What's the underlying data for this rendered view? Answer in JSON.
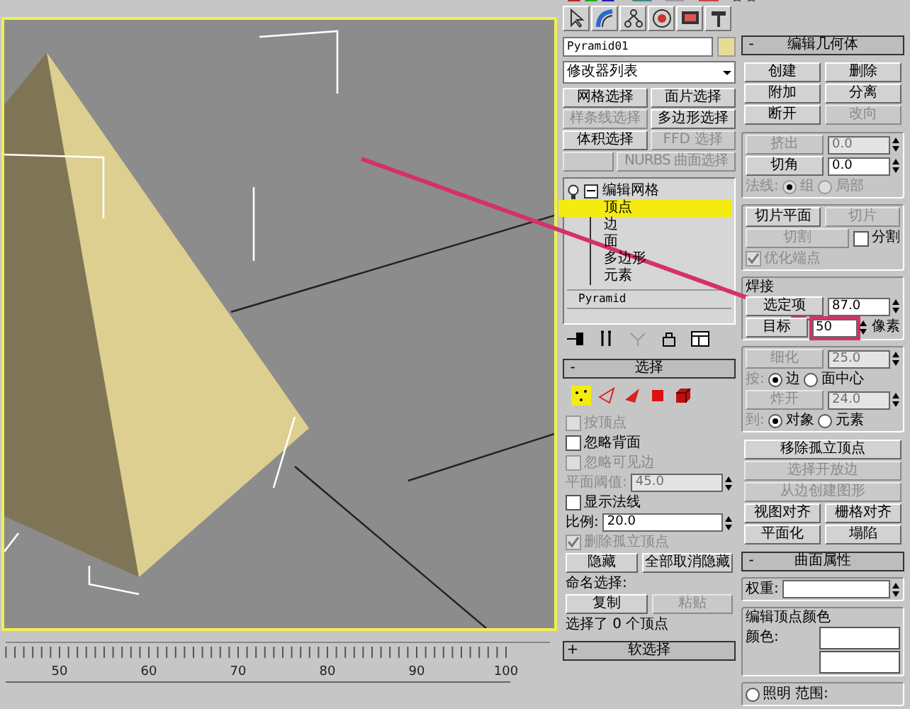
{
  "timeline": {
    "labels": [
      "50",
      "60",
      "70",
      "80",
      "90",
      "100"
    ]
  },
  "object_name": {
    "value": "Pyramid01"
  },
  "modifier_list": {
    "value": "修改器列表"
  },
  "modifier_buttons": [
    {
      "label": "网格选择",
      "disabled": false
    },
    {
      "label": "面片选择",
      "disabled": false
    },
    {
      "label": "样条线选择",
      "disabled": true
    },
    {
      "label": "多边形选择",
      "disabled": false
    },
    {
      "label": "体积选择",
      "disabled": false
    },
    {
      "label": "FFD 选择",
      "disabled": true
    },
    {
      "disabled": true
    },
    {
      "label": "NURBS 曲面选择",
      "disabled": true
    }
  ],
  "stack": [
    {
      "label": "编辑网格",
      "expanded": true,
      "children": [
        {
          "label": "顶点",
          "selected": true
        },
        {
          "label": "边",
          "selected": false
        },
        {
          "label": "面",
          "selected": false
        },
        {
          "label": "多边形",
          "selected": false
        },
        {
          "label": "元素",
          "selected": false
        }
      ]
    },
    {
      "label": "Pyramid"
    }
  ],
  "selection": {
    "title": "选择",
    "sign": "-",
    "levels": [
      {
        "kind": "vertex",
        "selected": true
      },
      {
        "kind": "edge",
        "selected": false
      },
      {
        "kind": "face",
        "selected": false
      },
      {
        "kind": "polygon",
        "selected": false
      },
      {
        "kind": "element",
        "selected": false
      }
    ],
    "rows": [
      {
        "items": [
          {
            "kind": "checkbox",
            "label": "按顶点",
            "checked": false,
            "disabled": true
          }
        ]
      },
      {
        "items": [
          {
            "kind": "checkbox",
            "label": "忽略背面",
            "checked": false,
            "disabled": false
          }
        ]
      },
      {
        "items": [
          {
            "kind": "checkbox",
            "label": "忽略可见边",
            "checked": false,
            "disabled": true
          }
        ]
      },
      {
        "items": [
          {
            "kind": "label",
            "text": "平面阈值:",
            "disabled": true
          },
          {
            "kind": "field",
            "value": "45.0",
            "disabled": true
          }
        ]
      },
      {
        "items": [
          {
            "kind": "checkbox",
            "label": "显示法线",
            "checked": false,
            "disabled": false
          }
        ]
      },
      {
        "items": [
          {
            "kind": "label",
            "text": "比例:",
            "disabled": false
          },
          {
            "kind": "field",
            "value": "20.0",
            "disabled": false
          }
        ]
      },
      {
        "items": [
          {
            "kind": "checkbox",
            "label": "删除孤立顶点",
            "checked": true,
            "disabled": true
          }
        ]
      },
      {
        "items": [
          {
            "kind": "button",
            "label": "隐藏",
            "disabled": false
          },
          {
            "kind": "button",
            "label": "全部取消隐藏",
            "disabled": false
          }
        ]
      },
      {
        "items": [
          {
            "kind": "label",
            "text": "命名选择:",
            "disabled": false
          }
        ]
      },
      {
        "items": [
          {
            "kind": "button",
            "label": "复制",
            "disabled": false
          },
          {
            "kind": "button",
            "label": "粘贴",
            "disabled": true
          }
        ]
      },
      {
        "items": [
          {
            "kind": "label",
            "text": "选择了 0 个顶点",
            "disabled": false
          }
        ]
      }
    ]
  },
  "soft_selection": {
    "title": "软选择",
    "sign": "+"
  },
  "edit_geometry": {
    "title": "编辑几何体",
    "sign": "-",
    "groups": [
      {
        "boxed": false,
        "rows": [
          {
            "items": [
              {
                "kind": "button",
                "label": "创建",
                "disabled": false
              },
              {
                "kind": "button",
                "label": "删除",
                "disabled": false
              }
            ]
          },
          {
            "items": [
              {
                "kind": "button",
                "label": "附加",
                "disabled": false
              },
              {
                "kind": "button",
                "label": "分离",
                "disabled": false
              }
            ]
          },
          {
            "items": [
              {
                "kind": "button",
                "label": "断开",
                "disabled": false
              },
              {
                "kind": "button",
                "label": "改向",
                "disabled": true
              }
            ]
          }
        ]
      },
      {
        "boxed": true,
        "rows": [
          {
            "items": [
              {
                "kind": "button",
                "label": "挤出",
                "disabled": true
              },
              {
                "kind": "field",
                "value": "0.0",
                "disabled": true
              }
            ]
          },
          {
            "items": [
              {
                "kind": "button",
                "label": "切角",
                "disabled": false
              },
              {
                "kind": "field",
                "value": "0.0",
                "disabled": false
              }
            ]
          },
          {
            "items": [
              {
                "kind": "label",
                "text": "法线:",
                "disabled": true
              },
              {
                "kind": "radio",
                "label": "组",
                "selected": true,
                "disabled": true
              },
              {
                "kind": "radio",
                "label": "局部",
                "selected": false,
                "disabled": true
              }
            ]
          }
        ]
      },
      {
        "boxed": true,
        "rows": [
          {
            "items": [
              {
                "kind": "button",
                "label": "切片平面",
                "disabled": false
              },
              {
                "kind": "button",
                "label": "切片",
                "disabled": true
              }
            ]
          },
          {
            "items": [
              {
                "kind": "button",
                "label": "切割",
                "disabled": true
              },
              {
                "kind": "checkbox",
                "label": "分割",
                "checked": false,
                "disabled": false
              }
            ]
          },
          {
            "items": [
              {
                "kind": "checkbox",
                "label": "优化端点",
                "checked": true,
                "disabled": true
              }
            ]
          }
        ]
      },
      {
        "boxed": true,
        "title": "焊接",
        "rows": [
          {
            "items": [
              {
                "kind": "button",
                "label": "选定项",
                "disabled": false
              },
              {
                "kind": "field",
                "value": "87.0",
                "disabled": false
              }
            ]
          },
          {
            "items": [
              {
                "kind": "button",
                "label": "目标",
                "disabled": false
              },
              {
                "kind": "field",
                "value": "50",
                "disabled": false,
                "highlighted": true
              },
              {
                "kind": "label",
                "text": "像素",
                "disabled": false
              }
            ]
          }
        ]
      },
      {
        "boxed": true,
        "rows": [
          {
            "items": [
              {
                "kind": "button",
                "label": "细化",
                "disabled": true
              },
              {
                "kind": "field",
                "value": "25.0",
                "disabled": true
              }
            ]
          },
          {
            "items": [
              {
                "kind": "label",
                "text": "按:",
                "disabled": true
              },
              {
                "kind": "radio",
                "label": "边",
                "selected": true,
                "disabled": false
              },
              {
                "kind": "radio",
                "label": "面中心",
                "selected": false,
                "disabled": false
              }
            ]
          },
          {
            "items": [
              {
                "kind": "button",
                "label": "炸开",
                "disabled": true
              },
              {
                "kind": "field",
                "value": "24.0",
                "disabled": true
              }
            ]
          },
          {
            "items": [
              {
                "kind": "label",
                "text": "到:",
                "disabled": true
              },
              {
                "kind": "radio",
                "label": "对象",
                "selected": true,
                "disabled": false
              },
              {
                "kind": "radio",
                "label": "元素",
                "selected": false,
                "disabled": false
              }
            ]
          }
        ]
      },
      {
        "boxed": false,
        "rows": [
          {
            "items": [
              {
                "kind": "button",
                "label": "移除孤立顶点",
                "disabled": false
              }
            ]
          },
          {
            "items": [
              {
                "kind": "button",
                "label": "选择开放边",
                "disabled": true
              }
            ]
          },
          {
            "items": [
              {
                "kind": "button",
                "label": "从边创建图形",
                "disabled": true
              }
            ]
          },
          {
            "items": [
              {
                "kind": "button",
                "label": "视图对齐",
                "disabled": false
              },
              {
                "kind": "button",
                "label": "栅格对齐",
                "disabled": false
              }
            ]
          },
          {
            "items": [
              {
                "kind": "button",
                "label": "平面化",
                "disabled": false
              },
              {
                "kind": "button",
                "label": "塌陷",
                "disabled": false
              }
            ]
          }
        ]
      }
    ]
  },
  "surface_properties": {
    "title": "曲面属性",
    "sign": "-",
    "groups": [
      {
        "boxed": true,
        "rows": [
          {
            "items": [
              {
                "kind": "label",
                "text": "权重:",
                "disabled": false
              },
              {
                "kind": "field",
                "disabled": false
              }
            ]
          }
        ]
      },
      {
        "boxed": true,
        "title": "编辑顶点颜色",
        "rows": [
          {
            "items": [
              {
                "kind": "label",
                "text": "颜色:",
                "disabled": false
              },
              {
                "kind": "swatch"
              }
            ]
          },
          {
            "items": [
              {
                "kind": "swatch"
              }
            ]
          }
        ]
      },
      {
        "boxed": true,
        "rows": [
          {
            "items": [
              {
                "kind": "radio",
                "label": "照明",
                "selected": false,
                "disabled": false
              },
              {
                "kind": "label",
                "text": "范围:",
                "disabled": false
              }
            ]
          }
        ]
      }
    ]
  }
}
